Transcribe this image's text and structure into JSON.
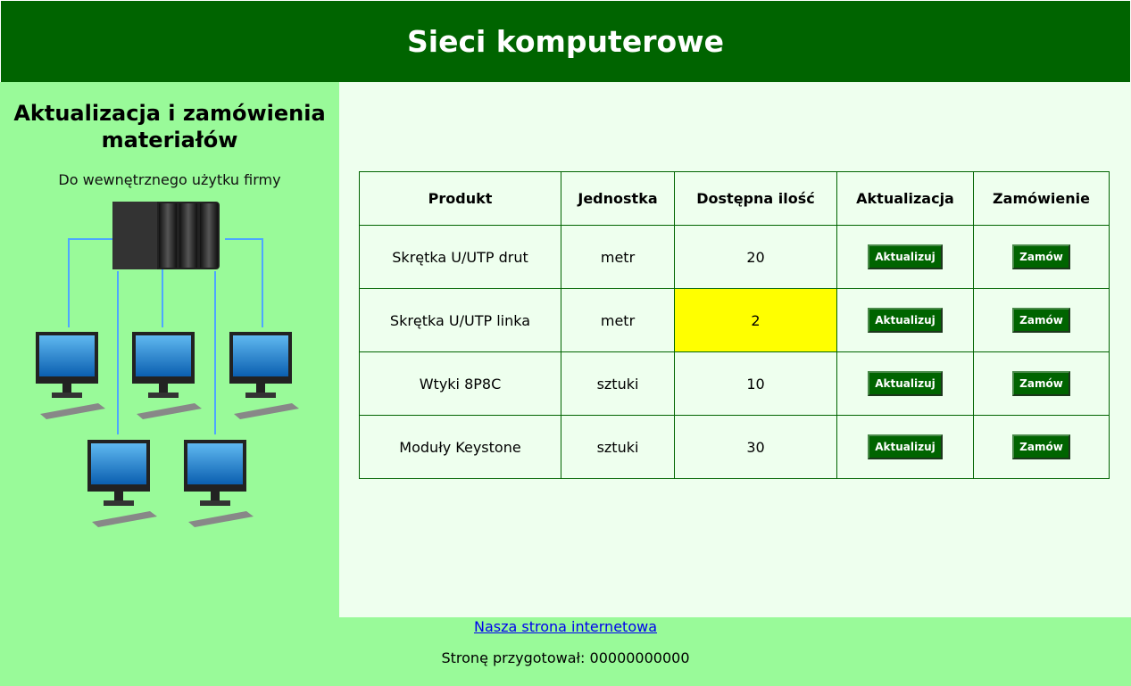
{
  "header": {
    "title": "Sieci komputerowe"
  },
  "left": {
    "heading": "Aktualizacja i zamówienia materiałów",
    "subtitle": "Do wewnętrznego użytku firmy",
    "image": "network-diagram-server-computers"
  },
  "table": {
    "headers": [
      "Produkt",
      "Jednostka",
      "Dostępna ilość",
      "Aktualizacja",
      "Zamówienie"
    ],
    "rows": [
      {
        "product": "Skrętka U/UTP drut",
        "unit": "metr",
        "qty": "20",
        "update_label": "Aktualizuj",
        "order_label": "Zamów",
        "qty_highlight": ""
      },
      {
        "product": "Skrętka U/UTP linka",
        "unit": "metr",
        "qty": "2",
        "update_label": "Aktualizuj",
        "order_label": "Zamów",
        "qty_highlight": "#FFFF00"
      },
      {
        "product": "Wtyki 8P8C",
        "unit": "sztuki",
        "qty": "10",
        "update_label": "Aktualizuj",
        "order_label": "Zamów",
        "qty_highlight": ""
      },
      {
        "product": "Moduły Keystone",
        "unit": "sztuki",
        "qty": "30",
        "update_label": "Aktualizuj",
        "order_label": "Zamów",
        "qty_highlight": ""
      }
    ]
  },
  "footer": {
    "link_text": "Nasza strona internetowa",
    "prepared_by": "Stronę przygotował: 00000000000"
  },
  "colors": {
    "header_bg": "#006400",
    "side_bg": "#99FA99",
    "main_bg": "#EEFFEE",
    "highlight": "#FFFF00"
  }
}
